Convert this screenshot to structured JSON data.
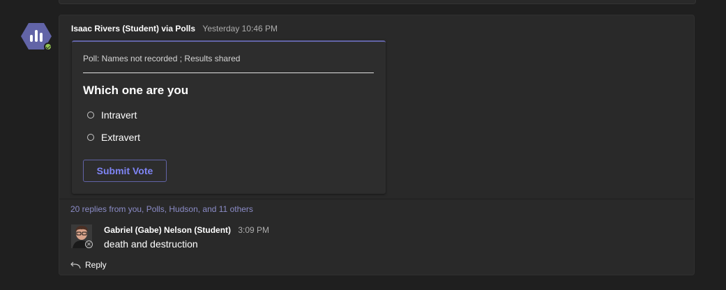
{
  "poll_message": {
    "author": "Isaac Rivers (Student) via Polls",
    "timestamp": "Yesterday 10:46 PM",
    "avatar_icon": "polls-app-icon",
    "presence": "available"
  },
  "poll_card": {
    "info": "Poll: Names not recorded ; Results shared",
    "question": "Which one are you",
    "options": [
      {
        "label": "Intravert"
      },
      {
        "label": "Extravert"
      }
    ],
    "submit_label": "Submit Vote"
  },
  "thread": {
    "replies_summary": "20 replies from you, Polls, Hudson, and 11 others"
  },
  "latest_reply": {
    "author": "Gabriel (Gabe) Nelson (Student)",
    "timestamp": "3:09 PM",
    "text": "death and destruction"
  },
  "reply_action": {
    "label": "Reply",
    "icon": "reply-arrow-icon"
  },
  "colors": {
    "accent": "#6264a7",
    "accent_text": "#7f85f5",
    "link": "#8b8cc7",
    "background": "#1f1f1f",
    "card": "#292929"
  }
}
